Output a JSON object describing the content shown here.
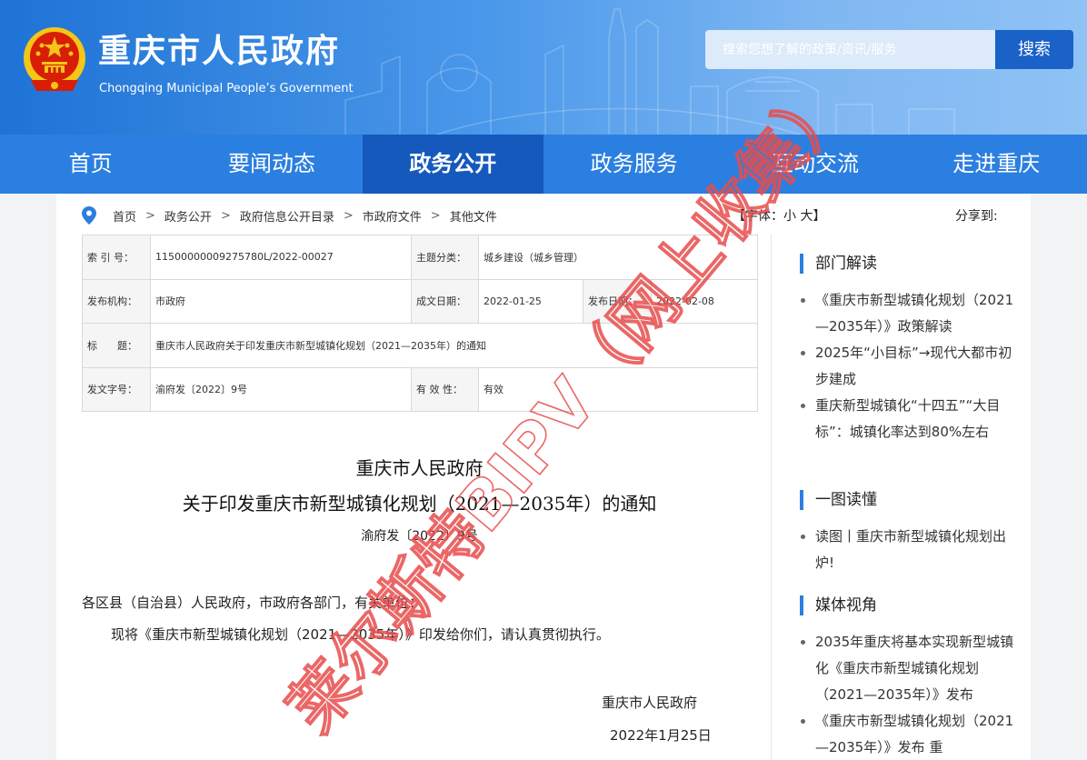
{
  "header": {
    "title": "重庆市人民政府",
    "subtitle": "Chongqing Municipal People’s Government",
    "search_placeholder": "搜索您想了解的政策/资讯/服务",
    "search_button": "搜索"
  },
  "nav": {
    "items": [
      {
        "label": "首页"
      },
      {
        "label": "要闻动态"
      },
      {
        "label": "政务公开"
      },
      {
        "label": "政务服务"
      },
      {
        "label": "互动交流"
      },
      {
        "label": "走进重庆"
      }
    ],
    "active": "政务公开"
  },
  "breadcrumb": [
    "首页",
    "政务公开",
    "政府信息公开目录",
    "市政府文件",
    "其他文件"
  ],
  "breadcrumb_separator": ">",
  "font_size": {
    "prefix": "【字体：",
    "small": "小",
    "large": "大",
    "suffix": "】"
  },
  "share_label": "分享到:",
  "info_table": {
    "index_label": "索 引 号：",
    "index_value": "11500000009275780L/2022-00027",
    "category_label": "主题分类：",
    "category_value": "城乡建设（城乡管理）",
    "issuer_label": "发布机构：",
    "issuer_value": "市政府",
    "created_label": "成文日期：",
    "created_value": "2022-01-25",
    "published_label": "发布日期：",
    "published_value": "2022-02-08",
    "title_label": "标　　题：",
    "title_value": "重庆市人民政府关于印发重庆市新型城镇化规划（2021—2035年）的通知",
    "docno_label": "发文字号：",
    "docno_value": "渝府发〔2022〕9号",
    "validity_label": "有 效 性：",
    "validity_value": "有效"
  },
  "document": {
    "issuer": "重庆市人民政府",
    "title": "关于印发重庆市新型城镇化规划（2021—2035年）的通知",
    "number": "渝府发〔2022〕9号",
    "salutation": "各区县（自治县）人民政府，市政府各部门，有关单位：",
    "body": "现将《重庆市新型城镇化规划（2021—2035年）》印发给你们，请认真贯彻执行。",
    "signer": "重庆市人民政府",
    "date": "2022年1月25日"
  },
  "sidebar": {
    "sections": [
      {
        "heading": "部门解读",
        "items": [
          {
            "label": "《重庆市新型城镇化规划（2021—2035年）》政策解读"
          },
          {
            "label": "2025年“小目标”→现代大都市初步建成"
          },
          {
            "label": "重庆新型城镇化“十四五”“大目标”：城镇化率达到80%左右"
          }
        ]
      },
      {
        "heading": "一图读懂",
        "items": [
          {
            "label": "读图丨重庆市新型城镇化规划出炉!"
          }
        ]
      },
      {
        "heading": "媒体视角",
        "items": [
          {
            "label": "2035年重庆将基本实现新型城镇化《重庆市新型城镇化规划（2021—2035年）》发布"
          },
          {
            "label": "《重庆市新型城镇化规划（2021—2035年）》发布 重"
          }
        ]
      }
    ]
  },
  "watermark": "莱尔斯特BIPV（网上收集）",
  "colors": {
    "header_blue": "#1f73d6",
    "nav_blue": "#2b7fe0",
    "nav_active": "#1559bd",
    "search_button": "#1a61c8",
    "watermark_red": "#e84c4c"
  }
}
